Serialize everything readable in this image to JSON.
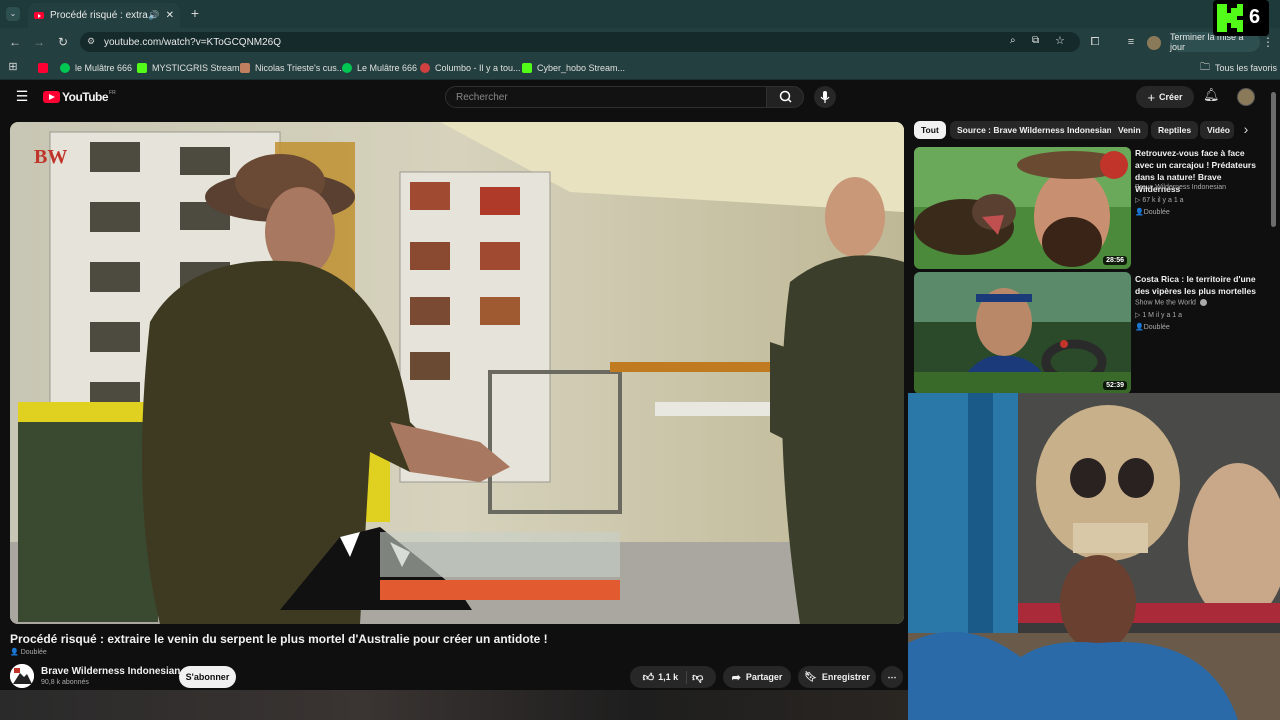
{
  "browser": {
    "tab_title": "Procédé risqué : extraire le",
    "url": "youtube.com/watch?v=KToGCQNM26Q",
    "update_button": "Terminer la mise à jour",
    "bookmarks": [
      {
        "label": "le Mulâtre 666",
        "color": "#00c853"
      },
      {
        "label": "MYSTICGRIS Stream...",
        "color": "#53fc18"
      },
      {
        "label": "Nicolas Trieste's cus...",
        "color": "#c08060"
      },
      {
        "label": "Le Mulâtre 666",
        "color": "#00c853"
      },
      {
        "label": "Columbo - Il y a tou...",
        "color": "#d04040"
      },
      {
        "label": "Cyber_hobo Stream...",
        "color": "#53fc18"
      }
    ],
    "all_bookmarks": "Tous les favoris"
  },
  "youtube": {
    "logo_text": "YouTube",
    "logo_region": "FR",
    "search_placeholder": "Rechercher",
    "create_label": "Créer"
  },
  "video": {
    "title": "Procédé risqué : extraire le venin du serpent le plus mortel d'Australie pour créer un antidote !",
    "dub_label": "Doublée",
    "channel_name": "Brave Wilderness Indonesian",
    "subscribers": "90,8 k abonnés",
    "subscribe_label": "S'abonner",
    "likes": "1,1 k",
    "share_label": "Partager",
    "save_label": "Enregistrer",
    "watermark": "BW"
  },
  "chips": [
    "Tout",
    "Source : Brave Wilderness Indonesian",
    "Venin",
    "Reptiles",
    "Vidéo"
  ],
  "recommendations": [
    {
      "title": "Retrouvez-vous face à face avec un carcajou ! Prédateurs dans la nature! Brave Wilderness",
      "channel": "Brave Wilderness Indonesian",
      "stats": "67 k  il y a 1 a",
      "badge": "Doublée",
      "duration": "28:56"
    },
    {
      "title": "Costa Rica : le territoire d'une des vipères les plus mortelles",
      "channel": "Show Me the World",
      "stats": "1 M  il y a 1 a",
      "badge": "Doublée",
      "duration": "52:39"
    }
  ],
  "overlay": {
    "kick_count": "6"
  }
}
